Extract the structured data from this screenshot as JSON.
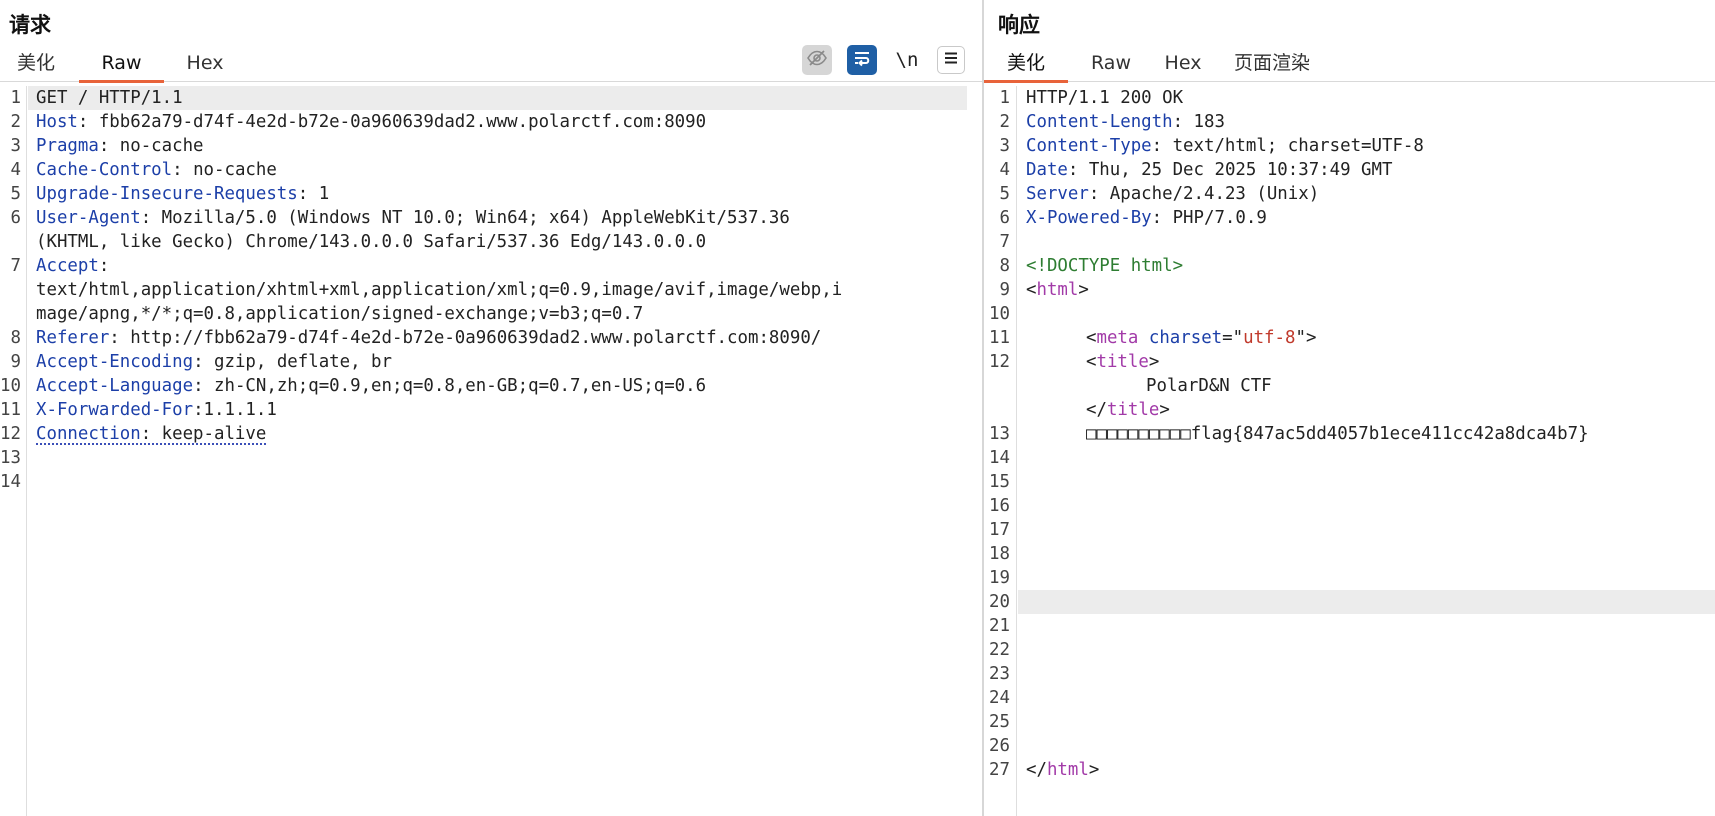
{
  "request": {
    "title": "请求",
    "tabs": [
      "美化",
      "Raw",
      "Hex"
    ],
    "active_tab": "Raw",
    "toolbar": {
      "hide_icon": "eye-off-icon",
      "wrap_icon": "word-wrap-icon",
      "newline_label": "\\n",
      "menu_icon": "hamburger-menu-icon"
    },
    "line_numbers": [
      "1",
      "2",
      "3",
      "4",
      "5",
      "6",
      "7",
      "8",
      "9",
      "10",
      "11",
      "12",
      "13",
      "14"
    ],
    "lines": [
      {
        "name": "",
        "value": "GET / HTTP/1.1"
      },
      {
        "name": "Host",
        "value": ": fbb62a79-d74f-4e2d-b72e-0a960639dad2.www.polarctf.com:8090"
      },
      {
        "name": "Pragma",
        "value": ": no-cache"
      },
      {
        "name": "Cache-Control",
        "value": ": no-cache"
      },
      {
        "name": "Upgrade-Insecure-Requests",
        "value": ": 1"
      },
      {
        "name": "User-Agent",
        "value": ": Mozilla/5.0 (Windows NT 10.0; Win64; x64) AppleWebKit/537.36",
        "cont": [
          "(KHTML, like Gecko) Chrome/143.0.0.0 Safari/537.36 Edg/143.0.0.0"
        ]
      },
      {
        "name": "Accept",
        "value": ":",
        "cont": [
          "text/html,application/xhtml+xml,application/xml;q=0.9,image/avif,image/webp,i",
          "mage/apng,*/*;q=0.8,application/signed-exchange;v=b3;q=0.7"
        ]
      },
      {
        "name": "Referer",
        "value": ": http://fbb62a79-d74f-4e2d-b72e-0a960639dad2.www.polarctf.com:8090/"
      },
      {
        "name": "Accept-Encoding",
        "value": ": gzip, deflate, br"
      },
      {
        "name": "Accept-Language",
        "value": ": zh-CN,zh;q=0.9,en;q=0.8,en-GB;q=0.7,en-US;q=0.6"
      },
      {
        "name": "X-Forwarded-For",
        "value": ":1.1.1.1"
      },
      {
        "name": "Connection",
        "value": ": keep-alive"
      },
      {
        "name": "",
        "value": ""
      },
      {
        "name": "",
        "value": ""
      }
    ]
  },
  "response": {
    "title": "响应",
    "tabs": [
      "美化",
      "Raw",
      "Hex",
      "页面渲染"
    ],
    "active_tab": "美化",
    "line_numbers": [
      "1",
      "2",
      "3",
      "4",
      "5",
      "6",
      "7",
      "8",
      "9",
      "10",
      "11",
      "12",
      "13",
      "14",
      "15",
      "16",
      "17",
      "18",
      "19",
      "20",
      "21",
      "22",
      "23",
      "24",
      "25",
      "26",
      "27"
    ],
    "lines": {
      "l1": "HTTP/1.1 200 OK",
      "l2_name": "Content-Length",
      "l2_value": ": 183",
      "l3_name": "Content-Type",
      "l3_value": ": text/html; charset=UTF-8",
      "l4_name": "Date",
      "l4_value": ": Thu, 25 Dec 2025 10:37:49 GMT",
      "l5_name": "Server",
      "l5_value": ": Apache/2.4.23 (Unix)",
      "l6_name": "X-Powered-By",
      "l6_value": ": PHP/7.0.9",
      "l8": "<!DOCTYPE html>",
      "l9_open": "<",
      "l9_tag": "html",
      "l9_close": ">",
      "l11_open": "<",
      "l11_tag": "meta",
      "l11_attr": "charset",
      "l11_eq": "=\"",
      "l11_val": "utf-8",
      "l11_end": "\">",
      "l12_open": "<",
      "l12_tag": "title",
      "l12_close": ">",
      "l12_text": "PolarD&N CTF",
      "l12_endopen": "</",
      "l12_endtag": "title",
      "l12_endclose": ">",
      "l13": "□□□□□□□□□□flag{847ac5dd4057b1ece411cc42a8dca4b7}",
      "l27_open": "</",
      "l27_tag": "html",
      "l27_close": ">"
    }
  }
}
